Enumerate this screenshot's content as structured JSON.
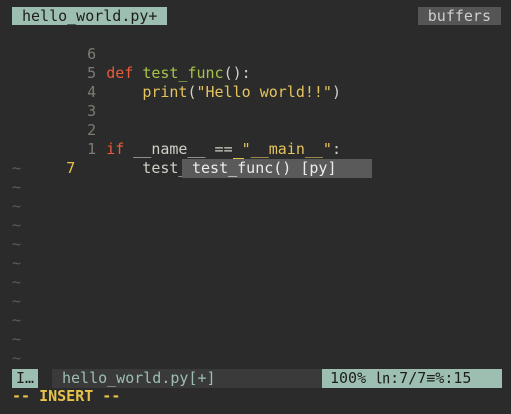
{
  "tabline": {
    "active_tab": "hello_world.py+",
    "buffers_label": "buffers"
  },
  "editor": {
    "lines": [
      {
        "num": "6",
        "code": ""
      },
      {
        "num": "5",
        "tokens": [
          [
            "kw",
            "def"
          ],
          [
            "plain",
            " "
          ],
          [
            "fn",
            "test_func"
          ],
          [
            "plain",
            "():"
          ]
        ]
      },
      {
        "num": "4",
        "tokens": [
          [
            "plain",
            "    "
          ],
          [
            "builtin",
            "print"
          ],
          [
            "plain",
            "("
          ],
          [
            "str",
            "\"Hello world!!\""
          ],
          [
            "plain",
            ")"
          ]
        ]
      },
      {
        "num": "3",
        "code": ""
      },
      {
        "num": "2",
        "code": ""
      },
      {
        "num": "1",
        "tokens": [
          [
            "kw",
            "if"
          ],
          [
            "plain",
            " __name__ == "
          ],
          [
            "str",
            "\"__main__\""
          ],
          [
            "plain",
            ":"
          ]
        ]
      }
    ],
    "current_line": {
      "num": "7",
      "before_cursor": "    test_func(",
      "cursor_char": ")"
    },
    "empty_marker": "~",
    "empty_rows": 11
  },
  "completion": {
    "item": "test_func() [py]"
  },
  "statusline": {
    "mode": "I…",
    "file": "hello_world.py[+]",
    "position": "100% ㏑:7/7≡%:15"
  },
  "cmdline": "-- INSERT --"
}
